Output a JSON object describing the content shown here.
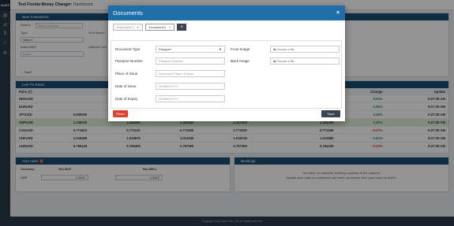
{
  "app": {
    "logo": "bizEX",
    "header_title": "Test Florida Money Changer:",
    "header_sub": " Dashboard",
    "footer": "Copyright 2018 bizEX Pte. Ltd. All rights reserved."
  },
  "new_transaction": {
    "title": "New Transaction",
    "search_label": "Search",
    "search_placeholder": "Search Customer",
    "type_label": "Type",
    "type_value": "Walk-in",
    "first_name_label": "First Name*",
    "nationality_label": "Nationality*",
    "nationality_value": "Select",
    "address_label": "Address Line",
    "back_label": "Back"
  },
  "fx": {
    "title": "Live FX Rates",
    "columns": [
      "Pairs (7)",
      "",
      "",
      "",
      "",
      "Low",
      "Change",
      "Update"
    ],
    "rows": [
      {
        "pair": "HKDUSD",
        "c1": "",
        "c2": "",
        "c3": "",
        "c4": "",
        "low": "0.127405",
        "change": "0.02%",
        "dir": "up",
        "update": "9:27:38 AM"
      },
      {
        "pair": "EURUSD",
        "c1": "",
        "c2": "",
        "c3": "",
        "c4": "",
        "low": "1.177506",
        "change": "0.36%",
        "dir": "up",
        "update": "9:27:39 AM"
      },
      {
        "pair": "JPYUSD",
        "c1": "0.009096",
        "c2": "0.009096",
        "c3": "0.009079",
        "c4": "0.009103",
        "low": "0.009078",
        "change": "0.18%",
        "dir": "up",
        "update": "9:27:38 AM"
      },
      {
        "pair": "GBPUSD",
        "c1": "1.346200",
        "c2": "1.346350",
        "c3": "1.341450",
        "c4": "1.347200",
        "low": "1.341400",
        "change": "0.36%",
        "dir": "up",
        "update": "9:27:39 AM"
      },
      {
        "pair": "CADUSD",
        "c1": "0.771810",
        "c2": "0.772110",
        "c3": "0.772530",
        "c4": "0.773200",
        "low": "0.771295",
        "change": "-0.07%",
        "dir": "down",
        "update": "9:27:39 AM"
      },
      {
        "pair": "CHFUSD",
        "c1": "1.018458",
        "c2": "1.018575",
        "c3": "1.014260",
        "c4": "1.018745",
        "low": "1.013580",
        "change": "0.42%",
        "dir": "up",
        "update": "9:27:39 AM"
      },
      {
        "pair": "AUDUSD",
        "c1": "0.765145",
        "c2": "0.765405",
        "c3": "0.767050",
        "c4": "0.767305",
        "low": "0.764425",
        "change": "-0.23%",
        "dir": "down",
        "update": "9:27:38 AM"
      }
    ]
  },
  "your_rates": {
    "title": "Your rates",
    "badge": "1",
    "col_currency": "Currency",
    "col_buy": "You BUY",
    "col_sell": "You SELL",
    "currency": "GBP",
    "buy_value": "1.3427",
    "sell_value": "1.3427"
  },
  "bookings": {
    "title": "Bookings",
    "line1": "You have no customer booking requests at the moment.",
    "line2": "Update your rates so customers can order currencies from your store on bizEX."
  },
  "modal": {
    "title": "Documents",
    "close": "×",
    "tabs": [
      {
        "label": "Document 1",
        "active": false
      },
      {
        "label": "Document 2",
        "active": true
      }
    ],
    "tab_close": "x",
    "add_tab": "+",
    "document_type_label": "Document Type",
    "document_type_value": "Passport",
    "passport_number_label": "Passport Number",
    "passport_number_placeholder": "Passport Number",
    "place_of_issue_label": "Place of Issue",
    "place_of_issue_placeholder": "Document Place of Issue",
    "date_of_issue_label": "Date of Issue",
    "date_of_issue_placeholder": "DD/MM/YYYY",
    "date_of_expiry_label": "Date of Expiry",
    "date_of_expiry_placeholder": "DD/MM/YYYY",
    "front_image_label": "Front Image",
    "back_image_label": "Back Image",
    "choose_file": "Choose a file",
    "reset_label": "Reset",
    "save_label": "Save"
  }
}
